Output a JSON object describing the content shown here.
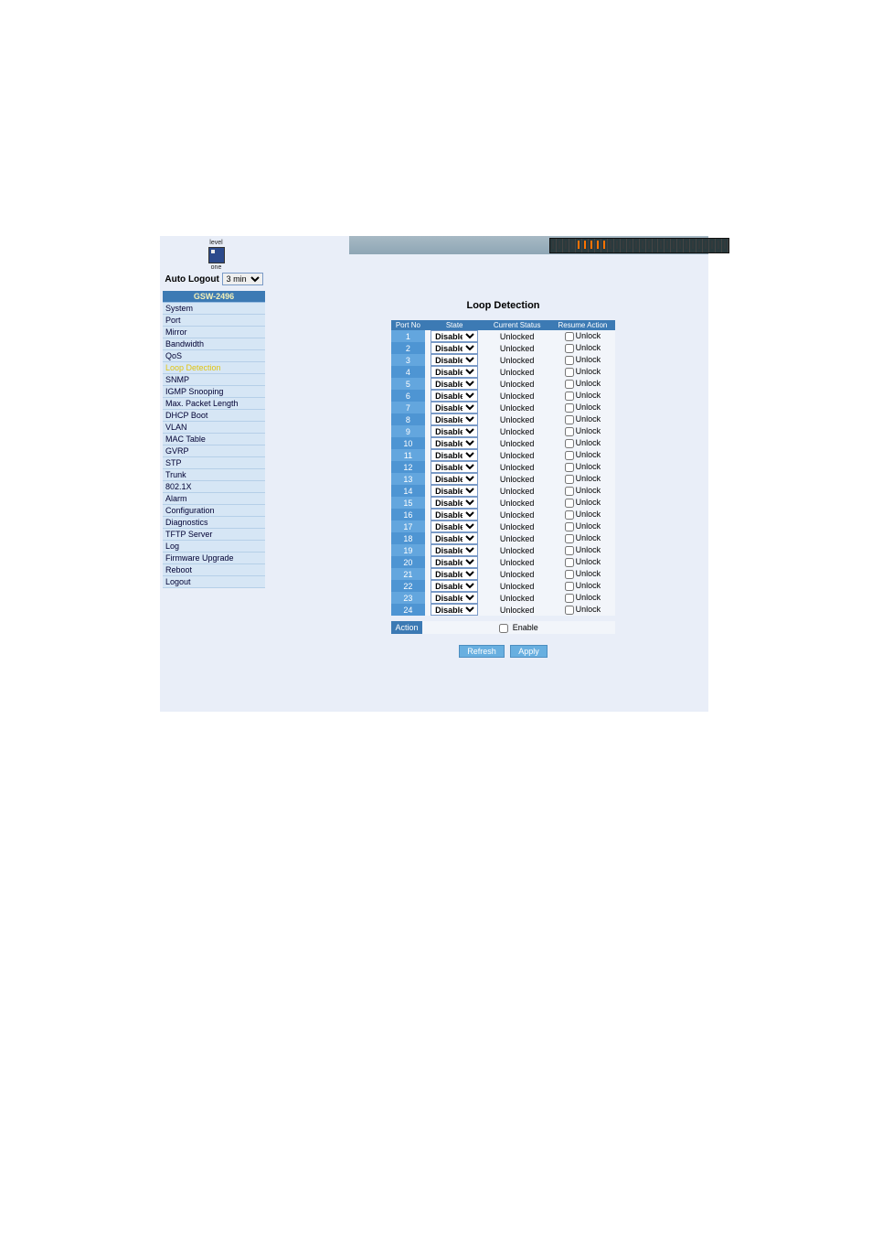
{
  "logo": {
    "line1": "level",
    "line2": "one"
  },
  "auto_logout": {
    "label": "Auto Logout",
    "value": "3 min"
  },
  "nav": {
    "header": "GSW-2496",
    "items": [
      "System",
      "Port",
      "Mirror",
      "Bandwidth",
      "QoS",
      "Loop Detection",
      "SNMP",
      "IGMP Snooping",
      "Max. Packet Length",
      "DHCP Boot",
      "VLAN",
      "MAC Table",
      "GVRP",
      "STP",
      "Trunk",
      "802.1X",
      "Alarm",
      "Configuration",
      "Diagnostics",
      "TFTP Server",
      "Log",
      "Firmware Upgrade",
      "Reboot",
      "Logout"
    ],
    "active_index": 5
  },
  "main": {
    "title": "Loop Detection",
    "columns": [
      "Port No",
      "State",
      "Current Status",
      "Resume Action"
    ],
    "state_option": "Disable",
    "rows": [
      {
        "port": "1",
        "state": "Disable",
        "status": "Unlocked",
        "resume": "Unlock"
      },
      {
        "port": "2",
        "state": "Disable",
        "status": "Unlocked",
        "resume": "Unlock"
      },
      {
        "port": "3",
        "state": "Disable",
        "status": "Unlocked",
        "resume": "Unlock"
      },
      {
        "port": "4",
        "state": "Disable",
        "status": "Unlocked",
        "resume": "Unlock"
      },
      {
        "port": "5",
        "state": "Disable",
        "status": "Unlocked",
        "resume": "Unlock"
      },
      {
        "port": "6",
        "state": "Disable",
        "status": "Unlocked",
        "resume": "Unlock"
      },
      {
        "port": "7",
        "state": "Disable",
        "status": "Unlocked",
        "resume": "Unlock"
      },
      {
        "port": "8",
        "state": "Disable",
        "status": "Unlocked",
        "resume": "Unlock"
      },
      {
        "port": "9",
        "state": "Disable",
        "status": "Unlocked",
        "resume": "Unlock"
      },
      {
        "port": "10",
        "state": "Disable",
        "status": "Unlocked",
        "resume": "Unlock"
      },
      {
        "port": "11",
        "state": "Disable",
        "status": "Unlocked",
        "resume": "Unlock"
      },
      {
        "port": "12",
        "state": "Disable",
        "status": "Unlocked",
        "resume": "Unlock"
      },
      {
        "port": "13",
        "state": "Disable",
        "status": "Unlocked",
        "resume": "Unlock"
      },
      {
        "port": "14",
        "state": "Disable",
        "status": "Unlocked",
        "resume": "Unlock"
      },
      {
        "port": "15",
        "state": "Disable",
        "status": "Unlocked",
        "resume": "Unlock"
      },
      {
        "port": "16",
        "state": "Disable",
        "status": "Unlocked",
        "resume": "Unlock"
      },
      {
        "port": "17",
        "state": "Disable",
        "status": "Unlocked",
        "resume": "Unlock"
      },
      {
        "port": "18",
        "state": "Disable",
        "status": "Unlocked",
        "resume": "Unlock"
      },
      {
        "port": "19",
        "state": "Disable",
        "status": "Unlocked",
        "resume": "Unlock"
      },
      {
        "port": "20",
        "state": "Disable",
        "status": "Unlocked",
        "resume": "Unlock"
      },
      {
        "port": "21",
        "state": "Disable",
        "status": "Unlocked",
        "resume": "Unlock"
      },
      {
        "port": "22",
        "state": "Disable",
        "status": "Unlocked",
        "resume": "Unlock"
      },
      {
        "port": "23",
        "state": "Disable",
        "status": "Unlocked",
        "resume": "Unlock"
      },
      {
        "port": "24",
        "state": "Disable",
        "status": "Unlocked",
        "resume": "Unlock"
      }
    ],
    "action_label": "Action",
    "enable_label": "Enable",
    "buttons": {
      "refresh": "Refresh",
      "apply": "Apply"
    }
  },
  "port_indicators": {
    "count": 28,
    "lit": [
      5,
      6,
      7,
      8,
      9
    ]
  },
  "colors": {
    "accent": "#3c7ab4",
    "page_bg": "#e9eef8"
  }
}
